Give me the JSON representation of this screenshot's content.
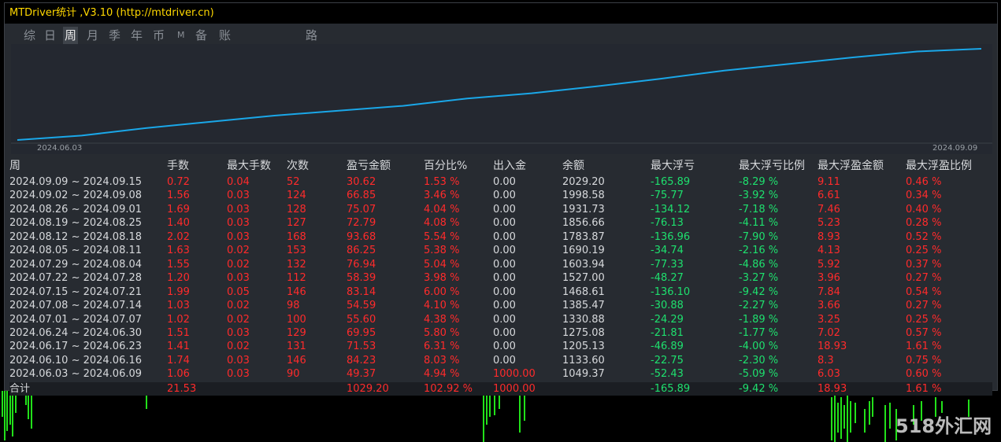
{
  "window": {
    "title": "MTDriver统计 ,V3.10 (http://mtdriver.cn)"
  },
  "tabs": [
    {
      "label": "综",
      "active": false
    },
    {
      "label": "日",
      "active": false
    },
    {
      "label": "周",
      "active": true
    },
    {
      "label": "月",
      "active": false
    },
    {
      "label": "季",
      "active": false
    },
    {
      "label": "年",
      "active": false
    },
    {
      "label": "币",
      "active": false
    },
    {
      "label": "M",
      "active": false
    },
    {
      "label": "备",
      "active": false
    },
    {
      "label": "账户",
      "active": false
    },
    {
      "label": "路径",
      "active": false
    }
  ],
  "equity_chart": {
    "x_start_label": "2024.06.03",
    "x_end_label": "2024.09.09",
    "line_color": "#1aa7e8"
  },
  "table": {
    "headers": [
      "周",
      "手数",
      "最大手数",
      "次数",
      "盈亏金额",
      "百分比%",
      "出入金",
      "余额",
      "最大浮亏",
      "最大浮亏比例",
      "最大浮盈金额",
      "最大浮盈比例"
    ],
    "rows": [
      [
        "2024.09.09 ~ 2024.09.15",
        "0.72",
        "0.04",
        "52",
        "30.62",
        "1.53 %",
        "0.00",
        "2029.20",
        "-165.89",
        "-8.29 %",
        "9.11",
        "0.46 %"
      ],
      [
        "2024.09.02 ~ 2024.09.08",
        "1.56",
        "0.03",
        "124",
        "66.85",
        "3.46 %",
        "0.00",
        "1998.58",
        "-75.77",
        "-3.92 %",
        "6.61",
        "0.34 %"
      ],
      [
        "2024.08.26 ~ 2024.09.01",
        "1.69",
        "0.03",
        "128",
        "75.07",
        "4.04 %",
        "0.00",
        "1931.73",
        "-134.12",
        "-7.18 %",
        "7.46",
        "0.40 %"
      ],
      [
        "2024.08.19 ~ 2024.08.25",
        "1.40",
        "0.03",
        "127",
        "72.79",
        "4.08 %",
        "0.00",
        "1856.66",
        "-76.13",
        "-4.11 %",
        "5.23",
        "0.28 %"
      ],
      [
        "2024.08.12 ~ 2024.08.18",
        "2.02",
        "0.03",
        "168",
        "93.68",
        "5.54 %",
        "0.00",
        "1783.87",
        "-136.96",
        "-7.90 %",
        "8.93",
        "0.52 %"
      ],
      [
        "2024.08.05 ~ 2024.08.11",
        "1.63",
        "0.02",
        "153",
        "86.25",
        "5.38 %",
        "0.00",
        "1690.19",
        "-34.74",
        "-2.16 %",
        "4.13",
        "0.25 %"
      ],
      [
        "2024.07.29 ~ 2024.08.04",
        "1.55",
        "0.02",
        "132",
        "76.94",
        "5.04 %",
        "0.00",
        "1603.94",
        "-77.33",
        "-4.86 %",
        "5.92",
        "0.37 %"
      ],
      [
        "2024.07.22 ~ 2024.07.28",
        "1.20",
        "0.03",
        "112",
        "58.39",
        "3.98 %",
        "0.00",
        "1527.00",
        "-48.27",
        "-3.27 %",
        "3.96",
        "0.27 %"
      ],
      [
        "2024.07.15 ~ 2024.07.21",
        "1.99",
        "0.05",
        "146",
        "83.14",
        "6.00 %",
        "0.00",
        "1468.61",
        "-136.10",
        "-9.42 %",
        "7.84",
        "0.54 %"
      ],
      [
        "2024.07.08 ~ 2024.07.14",
        "1.03",
        "0.02",
        "98",
        "54.59",
        "4.10 %",
        "0.00",
        "1385.47",
        "-30.88",
        "-2.27 %",
        "3.66",
        "0.27 %"
      ],
      [
        "2024.07.01 ~ 2024.07.07",
        "1.02",
        "0.02",
        "100",
        "55.60",
        "4.38 %",
        "0.00",
        "1330.88",
        "-24.29",
        "-1.89 %",
        "3.25",
        "0.25 %"
      ],
      [
        "2024.06.24 ~ 2024.06.30",
        "1.51",
        "0.03",
        "129",
        "69.95",
        "5.80 %",
        "0.00",
        "1275.08",
        "-21.81",
        "-1.77 %",
        "7.02",
        "0.57 %"
      ],
      [
        "2024.06.17 ~ 2024.06.23",
        "1.41",
        "0.02",
        "131",
        "71.53",
        "6.31 %",
        "0.00",
        "1205.13",
        "-46.89",
        "-4.00 %",
        "18.93",
        "1.61 %"
      ],
      [
        "2024.06.10 ~ 2024.06.16",
        "1.74",
        "0.03",
        "146",
        "84.23",
        "8.03 %",
        "0.00",
        "1133.60",
        "-22.75",
        "-2.30 %",
        "8.3",
        "0.75 %"
      ],
      [
        "2024.06.03 ~ 2024.06.09",
        "1.06",
        "0.03",
        "90",
        "49.37",
        "4.94 %",
        "1000.00",
        "1049.37",
        "-52.43",
        "-5.09 %",
        "6.03",
        "0.60 %"
      ]
    ],
    "total": [
      "合计",
      "21.53",
      "",
      "",
      "1029.20",
      "102.92 %",
      "1000.00",
      "",
      "-165.89",
      "-9.42 %",
      "18.93",
      "1.61 %"
    ]
  },
  "watermark": "518外汇网",
  "colors": {
    "positive": "#ff2b2b",
    "negative": "#1ee06e",
    "neutral": "#d7d9dc",
    "title": "#ffd800"
  }
}
